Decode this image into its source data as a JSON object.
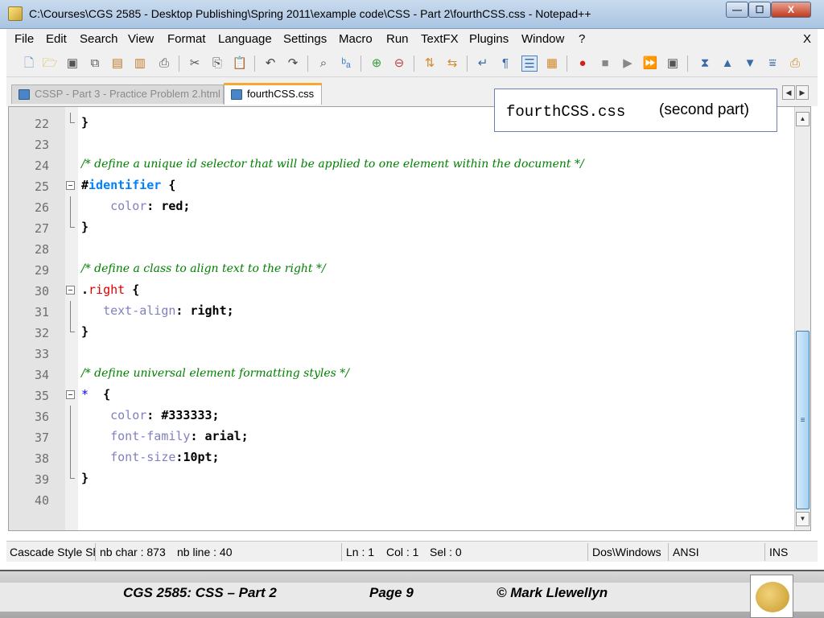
{
  "window": {
    "title": "C:\\Courses\\CGS 2585 - Desktop Publishing\\Spring 2011\\example code\\CSS - Part 2\\fourthCSS.css - Notepad++",
    "min_glyph": "—",
    "max_glyph": "☐",
    "close_glyph": "X"
  },
  "menu": {
    "items": [
      "File",
      "Edit",
      "Search",
      "View",
      "Format",
      "Language",
      "Settings",
      "Macro",
      "Run",
      "TextFX",
      "Plugins",
      "Window",
      "?"
    ],
    "close": "X"
  },
  "toolbar": {
    "icons": [
      "new-file-icon",
      "open-file-icon",
      "save-icon",
      "save-all-icon",
      "close-icon",
      "close-all-icon",
      "print-icon",
      "cut-icon",
      "copy-icon",
      "paste-icon",
      "undo-icon",
      "redo-icon",
      "find-icon",
      "replace-icon",
      "zoom-in-icon",
      "zoom-out-icon",
      "sync-vertical-icon",
      "sync-horizontal-icon",
      "word-wrap-icon",
      "show-all-chars-icon",
      "indent-guide-icon",
      "user-language-icon",
      "record-macro-icon",
      "stop-macro-icon",
      "play-macro-icon",
      "run-macro-multiple-icon",
      "save-macro-icon",
      "tool-a-icon",
      "tool-b-icon",
      "tool-c-icon",
      "tool-d-icon",
      "tool-e-icon"
    ]
  },
  "tabs": [
    {
      "label": "CSSP - Part 3 - Practice Problem 2.html",
      "active": false
    },
    {
      "label": "fourthCSS.css",
      "active": true
    }
  ],
  "callout": {
    "filename": "fourthCSS.css",
    "note": "(second part)"
  },
  "editor": {
    "lines": [
      {
        "n": "22",
        "text": "}"
      },
      {
        "n": "23",
        "text": ""
      },
      {
        "n": "24",
        "text": "/* define a unique id selector that will be applied to one element within the document */"
      },
      {
        "n": "25",
        "id_hash": "#",
        "id_name": "identifier",
        "brace": " {"
      },
      {
        "n": "26",
        "indent": "    ",
        "prop": "color",
        "colon": ": ",
        "value": "red;"
      },
      {
        "n": "27",
        "text": "}"
      },
      {
        "n": "28",
        "text": ""
      },
      {
        "n": "29",
        "text": "/* define a class to align text to the right */"
      },
      {
        "n": "30",
        "cls_dot": ".",
        "cls_name": "right",
        "brace": " {"
      },
      {
        "n": "31",
        "indent": "   ",
        "prop": "text-align",
        "colon": ": ",
        "value": "right;"
      },
      {
        "n": "32",
        "text": "}"
      },
      {
        "n": "33",
        "text": ""
      },
      {
        "n": "34",
        "text": "/* define universal element formatting styles */"
      },
      {
        "n": "35",
        "star": "*",
        "brace": "  {"
      },
      {
        "n": "36",
        "indent": "    ",
        "prop": "color",
        "colon": ": ",
        "value": "#333333;"
      },
      {
        "n": "37",
        "indent": "    ",
        "prop": "font-family",
        "colon": ": ",
        "value": "arial;"
      },
      {
        "n": "38",
        "indent": "    ",
        "prop": "font-size",
        "colon": ":",
        "value": "10pt;"
      },
      {
        "n": "39",
        "text": "}"
      },
      {
        "n": "40",
        "text": ""
      }
    ]
  },
  "scrollbar": {
    "up": "▲",
    "down": "▼",
    "grip": "≡"
  },
  "status": {
    "language": "Cascade Style Sh",
    "nb_char": "nb char : 873",
    "nb_line": "nb line : 40",
    "ln": "Ln : 1",
    "col": "Col : 1",
    "sel": "Sel : 0",
    "eol": "Dos\\Windows",
    "encoding": "ANSI",
    "mode": "INS"
  },
  "footer": {
    "course": "CGS 2585: CSS – Part 2",
    "page": "Page 9",
    "author": "© Mark Llewellyn"
  }
}
